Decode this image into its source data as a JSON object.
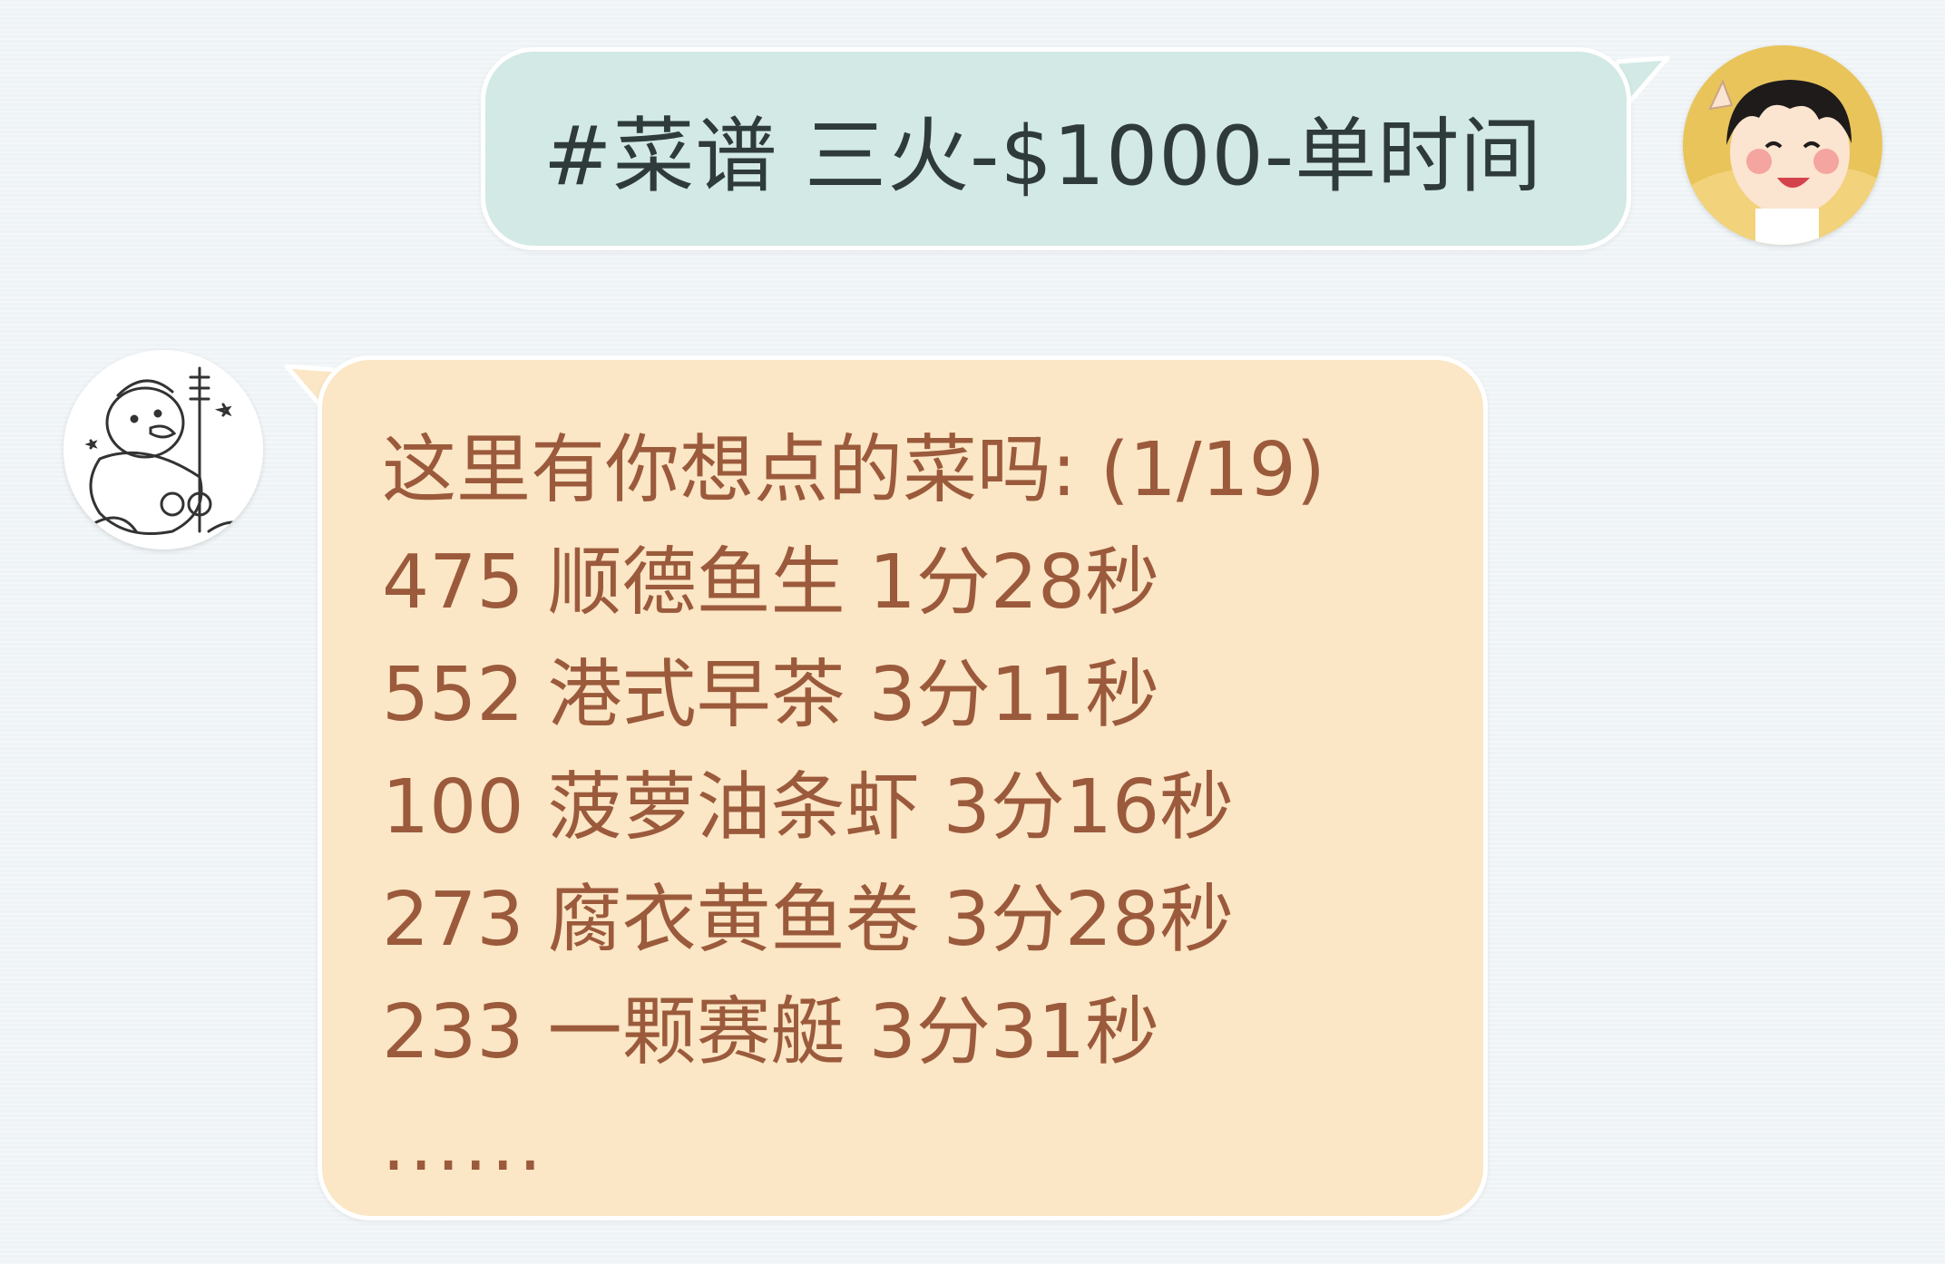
{
  "colors": {
    "background": "#eef3f6",
    "outgoing_bubble": "#d2e9e5",
    "outgoing_text": "#2f3b3a",
    "incoming_bubble": "#fbe6c5",
    "incoming_text": "#9b5a3c",
    "bubble_border": "#ffffff"
  },
  "outgoing_message": {
    "text": "#菜谱 三火-$1000-单时间",
    "avatar": "girl-avatar-icon"
  },
  "incoming_message": {
    "avatar": "sketch-duck-avatar-icon",
    "lines": [
      "这里有你想点的菜吗: (1/19)",
      "475 顺德鱼生 1分28秒",
      "552 港式早茶 3分11秒",
      "100 菠萝油条虾 3分16秒",
      "273 腐衣黄鱼卷 3分28秒",
      "233 一颗赛艇 3分31秒",
      "......"
    ]
  }
}
